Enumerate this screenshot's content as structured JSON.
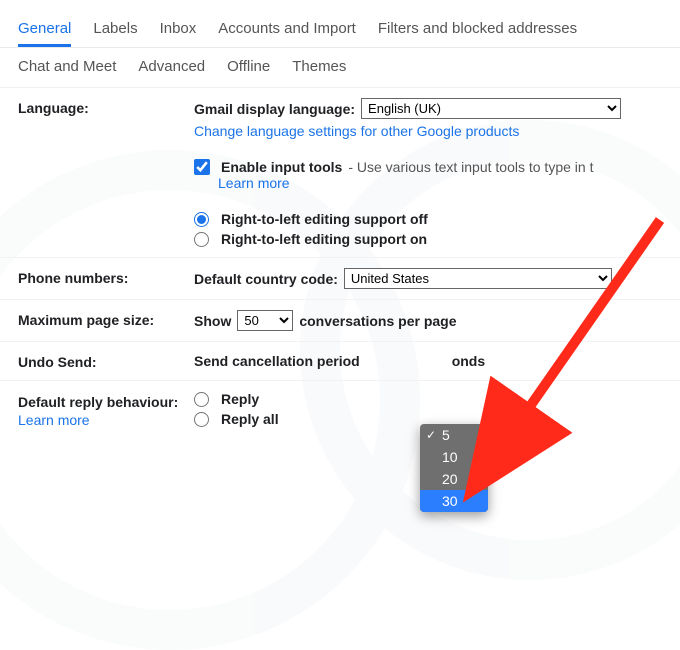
{
  "tabs_row1": [
    {
      "label": "General",
      "active": true
    },
    {
      "label": "Labels"
    },
    {
      "label": "Inbox"
    },
    {
      "label": "Accounts and Import"
    },
    {
      "label": "Filters and blocked addresses"
    }
  ],
  "tabs_row2": [
    {
      "label": "Chat and Meet"
    },
    {
      "label": "Advanced"
    },
    {
      "label": "Offline"
    },
    {
      "label": "Themes"
    }
  ],
  "language": {
    "label": "Language:",
    "display_label": "Gmail display language:",
    "display_value": "English (UK)",
    "change_link": "Change language settings for other Google products",
    "input_tools_label": "Enable input tools",
    "input_tools_desc": " - Use various text input tools to type in t",
    "learn_more": "Learn more",
    "rtl_off": "Right-to-left editing support off",
    "rtl_on": "Right-to-left editing support on"
  },
  "phone": {
    "label": "Phone numbers:",
    "cc_label": "Default country code:",
    "cc_value": "United States"
  },
  "page_size": {
    "label": "Maximum page size:",
    "show": "Show",
    "value": "50",
    "suffix": "conversations per page"
  },
  "undo": {
    "label": "Undo Send:",
    "prefix": "Send cancellation period",
    "suffix": "onds",
    "options": [
      {
        "v": "5",
        "checked": true
      },
      {
        "v": "10"
      },
      {
        "v": "20"
      },
      {
        "v": "30",
        "selected": true
      }
    ]
  },
  "reply": {
    "label": "Default reply behaviour:",
    "learn_more": "Learn more",
    "reply": "Reply",
    "reply_all": "Reply all"
  }
}
